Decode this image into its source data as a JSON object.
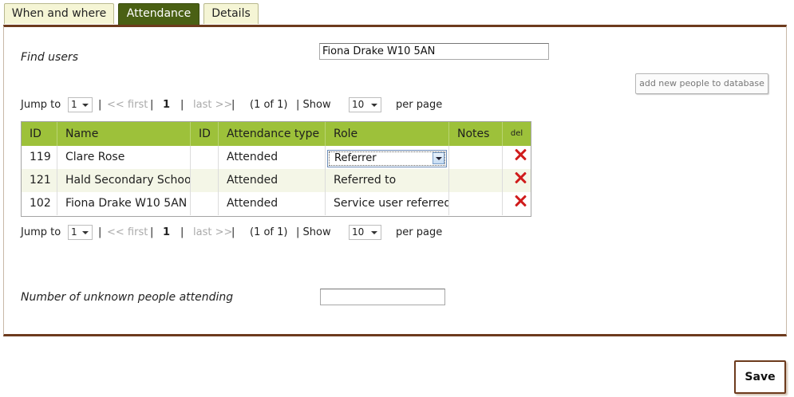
{
  "tabs": [
    {
      "label": "When and where",
      "active": false
    },
    {
      "label": "Attendance",
      "active": true
    },
    {
      "label": "Details",
      "active": false
    }
  ],
  "find_users": {
    "label": "Find users",
    "value": "Fiona Drake W10 5AN"
  },
  "add_button_label": "add new people to database",
  "pager": {
    "jump_to": "Jump to",
    "page_select": "1",
    "sep1": "|",
    "first": "<< first",
    "sep2": "|",
    "current": "1",
    "sep3": "|",
    "last": "last >>",
    "sep4": "|",
    "count": "(1 of 1)",
    "show": "| Show",
    "per_page_select": "10",
    "per_page": "per page"
  },
  "table": {
    "headers": {
      "id": "ID",
      "name": "Name",
      "id2": "ID",
      "attendance_type": "Attendance type",
      "role": "Role",
      "notes": "Notes",
      "del": "del"
    },
    "rows": [
      {
        "id": "119",
        "name": "Clare Rose",
        "id2": "",
        "attendance": "Attended",
        "role": "Referrer",
        "notes": ""
      },
      {
        "id": "121",
        "name": "Hald Secondary School",
        "id2": "",
        "attendance": "Attended",
        "role": "Referred to",
        "notes": ""
      },
      {
        "id": "102",
        "name": "Fiona Drake W10 5AN",
        "id2": "",
        "attendance": "Attended",
        "role": "Service user referred",
        "notes": ""
      }
    ]
  },
  "unknown_people": {
    "label": "Number of unknown people attending",
    "value": ""
  },
  "save_label": "Save",
  "colors": {
    "tab_active": "#4a6014",
    "tab_inactive": "#f5f5d5",
    "panel_border": "#6d3b1d",
    "table_header": "#9dc13a",
    "row_alt": "#f4f6e7",
    "delete_icon": "#d01c1c"
  },
  "icons": {
    "delete": "red-x-icon",
    "dropdown": "chevron-down-icon"
  }
}
